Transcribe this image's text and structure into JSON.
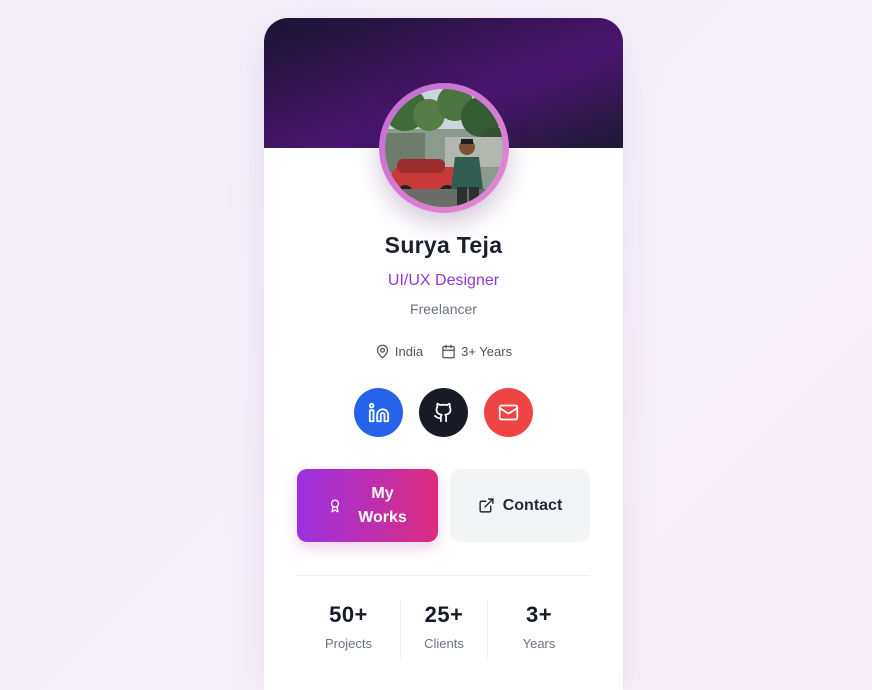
{
  "profile": {
    "name": "Surya Teja",
    "role": "UI/UX Designer",
    "status": "Freelancer",
    "location": "India",
    "experience": "3+ Years",
    "avatar_icon": "profile-photo"
  },
  "socials": [
    {
      "icon": "linkedin-icon",
      "color": "#2563eb"
    },
    {
      "icon": "github-icon",
      "color": "#161b26"
    },
    {
      "icon": "mail-icon",
      "color": "#ef4444"
    }
  ],
  "actions": {
    "works_label": "My Works",
    "contact_label": "Contact"
  },
  "stats": [
    {
      "value": "50+",
      "label": "Projects"
    },
    {
      "value": "25+",
      "label": "Clients"
    },
    {
      "value": "3+",
      "label": "Years"
    }
  ],
  "colors": {
    "accent": "#9238d6",
    "gradient_start": "#9b30e0",
    "gradient_end": "#de2c7d",
    "banner": "#3e1560"
  }
}
